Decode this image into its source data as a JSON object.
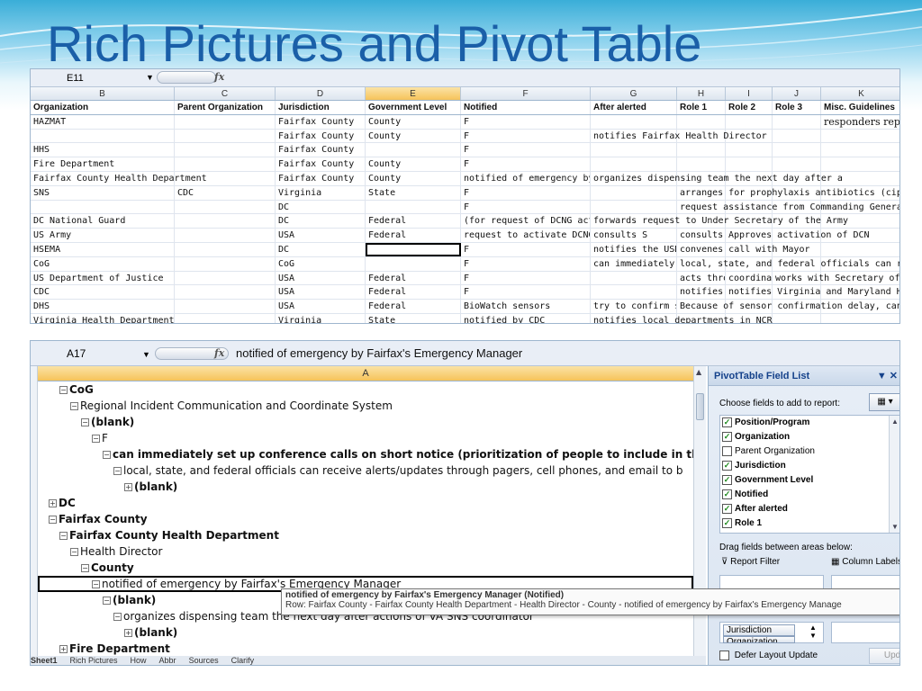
{
  "slide": {
    "title": "Rich Pictures and Pivot Table"
  },
  "top_sheet": {
    "name_box": "E11",
    "fx": "fx",
    "columns": [
      "B",
      "C",
      "D",
      "E",
      "F",
      "G",
      "H",
      "I",
      "J",
      "K"
    ],
    "headers": [
      "Organization",
      "Parent Organization",
      "Jurisdiction",
      "Government Level",
      "Notified",
      "After alerted",
      "Role 1",
      "Role 2",
      "Role 3",
      "Misc. Guidelines"
    ],
    "rows": [
      [
        "HAZMAT",
        "",
        "Fairfax County",
        "County",
        "F",
        "",
        "",
        "",
        "",
        "responders repo"
      ],
      [
        "",
        "",
        "Fairfax County",
        "County",
        "F",
        "notifies Fairfax Health Director",
        "",
        "",
        "",
        ""
      ],
      [
        "HHS",
        "",
        "Fairfax County",
        "",
        "F",
        "",
        "",
        "",
        "",
        ""
      ],
      [
        "Fire Department",
        "",
        "Fairfax County",
        "County",
        "F",
        "",
        "",
        "",
        "",
        ""
      ],
      [
        "Fairfax County Health Department",
        "",
        "Fairfax County",
        "County",
        "notified of emergency by Fairfax's Emergency",
        "organizes dispensing team the next day after a",
        "",
        "",
        "",
        ""
      ],
      [
        "SNS",
        "CDC",
        "Virginia",
        "State",
        "F",
        "",
        "arranges for prophylaxis antibiotics (ciproflox",
        "",
        "",
        ""
      ],
      [
        "",
        "",
        "DC",
        "",
        "F",
        "",
        "request assistance from Commanding General",
        "",
        "",
        ""
      ],
      [
        "DC National Guard",
        "",
        "DC",
        "Federal",
        "(for request of DCNG activa",
        "forwards request to Under Secretary of the Army",
        "",
        "",
        "",
        ""
      ],
      [
        "US Army",
        "",
        "USA",
        "Federal",
        "request to activate DCNG forwarded from the",
        "consults S",
        "consults A",
        "Approves activation of DCN",
        "",
        ""
      ],
      [
        "HSEMA",
        "",
        "DC",
        "",
        "F",
        "notifies the USDH",
        "convenes call with Mayor",
        "",
        "",
        ""
      ],
      [
        "CoG",
        "",
        "CoG",
        "",
        "F",
        "can immediately s",
        "local, state, and federal officials can receive a",
        "",
        "",
        ""
      ],
      [
        "US Department of Justice",
        "",
        "USA",
        "Federal",
        "F",
        "",
        "acts throu",
        "coordinat",
        "works with Secretary of De",
        ""
      ],
      [
        "CDC",
        "",
        "USA",
        "Federal",
        "F",
        "",
        "notifies D",
        "notifies Virginia and Maryland Heal",
        "",
        ""
      ],
      [
        "DHS",
        "",
        "USA",
        "Federal",
        "BioWatch sensors",
        "try to confirm sens",
        "Because of sensor confirmation delay, can del",
        "",
        "",
        ""
      ],
      [
        "Virginia Health Department",
        "",
        "Virginia",
        "State",
        "notified by CDC",
        "notifies local departments in NCR",
        "",
        "",
        "",
        ""
      ]
    ]
  },
  "bottom_sheet": {
    "name_box": "A17",
    "fx": "fx",
    "formula_text": "notified of emergency by Fairfax's Emergency Manager",
    "column": "A",
    "rows": [
      {
        "indent": 1,
        "toggle": "−",
        "bold": true,
        "text": "CoG"
      },
      {
        "indent": 2,
        "toggle": "−",
        "bold": false,
        "text": "Regional Incident Communication and Coordinate System"
      },
      {
        "indent": 3,
        "toggle": "−",
        "bold": true,
        "text": "(blank)"
      },
      {
        "indent": 4,
        "toggle": "−",
        "bold": false,
        "text": "F"
      },
      {
        "indent": 5,
        "toggle": "−",
        "bold": true,
        "text": "can immediately set up conference calls on short notice (prioritization of people to include in this is uncl"
      },
      {
        "indent": 6,
        "toggle": "−",
        "bold": false,
        "text": "local, state, and federal officials can receive alerts/updates through pagers, cell phones, and email to b"
      },
      {
        "indent": 7,
        "toggle": "+",
        "bold": true,
        "text": "(blank)"
      },
      {
        "indent": 0,
        "toggle": "+",
        "bold": true,
        "text": "DC"
      },
      {
        "indent": 0,
        "toggle": "−",
        "bold": true,
        "text": "Fairfax County"
      },
      {
        "indent": 1,
        "toggle": "−",
        "bold": true,
        "text": "Fairfax County Health Department"
      },
      {
        "indent": 2,
        "toggle": "−",
        "bold": false,
        "text": "Health Director"
      },
      {
        "indent": 3,
        "toggle": "−",
        "bold": true,
        "text": "County"
      },
      {
        "indent": 4,
        "toggle": "−",
        "bold": false,
        "text": "notified of emergency by Fairfax's Emergency Manager",
        "selected": true
      },
      {
        "indent": 5,
        "toggle": "−",
        "bold": true,
        "text": "(blank)"
      },
      {
        "indent": 6,
        "toggle": "−",
        "bold": false,
        "text": "organizes dispensing team the next day after actions of VA SNS coordinator"
      },
      {
        "indent": 7,
        "toggle": "+",
        "bold": true,
        "text": "(blank)"
      },
      {
        "indent": 1,
        "toggle": "+",
        "bold": true,
        "text": "Fire Department"
      }
    ],
    "tooltip": {
      "line1": "notified of emergency by Fairfax's Emergency Manager (Notified)",
      "line2": "Row: Fairfax County - Fairfax County Health Department - Health Director - County - notified of emergency by Fairfax's Emergency Manage"
    },
    "sheet_tabs": [
      "Sheet1",
      "Rich Pictures",
      "How",
      "Abbr",
      "Sources",
      "Clarify"
    ]
  },
  "pivot": {
    "title": "PivotTable Field List",
    "choose_label": "Choose fields to add to report:",
    "fields": [
      {
        "label": "Position/Program",
        "checked": true
      },
      {
        "label": "Organization",
        "checked": true
      },
      {
        "label": "Parent Organization",
        "checked": false
      },
      {
        "label": "Jurisdiction",
        "checked": true
      },
      {
        "label": "Government Level",
        "checked": true
      },
      {
        "label": "Notified",
        "checked": true
      },
      {
        "label": "After alerted",
        "checked": true
      },
      {
        "label": "Role 1",
        "checked": true
      }
    ],
    "drag_label": "Drag fields between areas below:",
    "report_filter": "Report Filter",
    "column_labels": "Column Labels",
    "row_fields": [
      "Jurisdiction",
      "Organization"
    ],
    "defer_label": "Defer Layout Update",
    "update_label": "Update"
  }
}
